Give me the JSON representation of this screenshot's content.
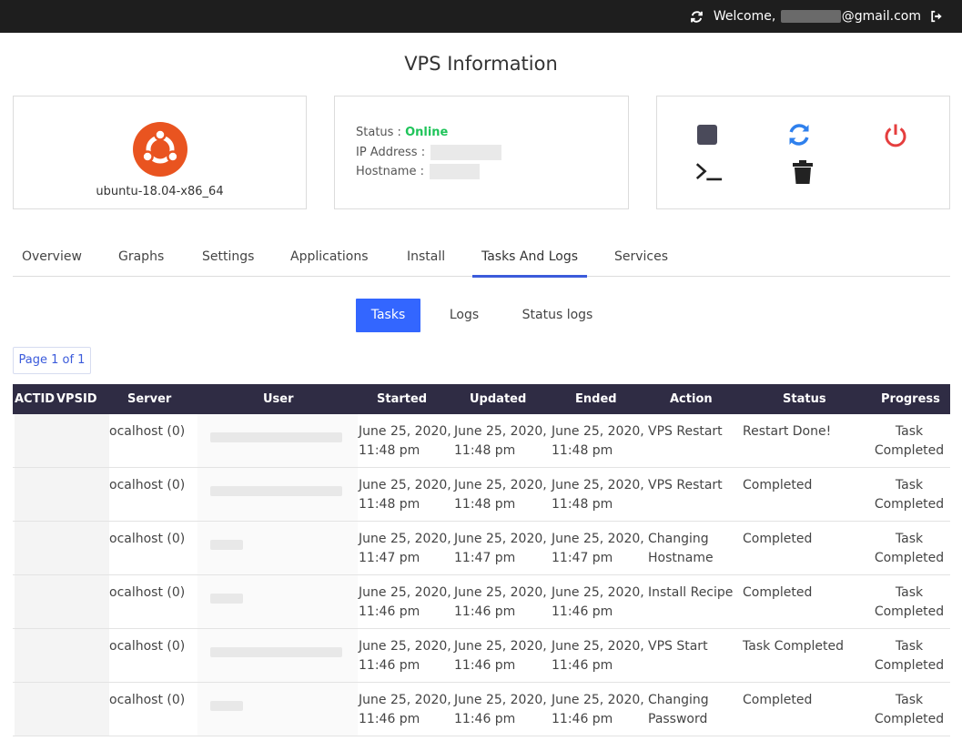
{
  "topbar": {
    "welcome_prefix": "Welcome, ",
    "email_redacted": "",
    "email_suffix": "@gmail.com",
    "refresh_icon": "refresh-icon",
    "logout_icon": "logout-icon"
  },
  "page_title": "VPS Information",
  "os": {
    "name": "ubuntu-18.04-x86_64",
    "logo_icon": "ubuntu-logo-icon",
    "logo_color": "#e95420"
  },
  "info": {
    "status_label": "Status : ",
    "status_value": "Online",
    "status_color": "#1fc45a",
    "ip_label": "IP Address : ",
    "ip_value": "",
    "hostname_label": "Hostname : ",
    "hostname_value": ""
  },
  "actions": {
    "stop_icon": "stop-icon",
    "restart_icon": "restart-icon",
    "power_icon": "power-icon",
    "console_icon": "console-icon",
    "delete_icon": "trash-icon",
    "accent_colors": {
      "stop": "#4a4a5a",
      "restart": "#2f80ed",
      "power": "#e53e3e",
      "console": "#222222",
      "delete": "#222222"
    }
  },
  "tabs": [
    "Overview",
    "Graphs",
    "Settings",
    "Applications",
    "Install",
    "Tasks And Logs",
    "Services"
  ],
  "active_tab": "Tasks And Logs",
  "subtabs": [
    "Tasks",
    "Logs",
    "Status logs"
  ],
  "active_subtab": "Tasks",
  "pagination": {
    "label": "Page 1 of 1"
  },
  "table": {
    "headers": [
      "ACTID",
      "VPSID",
      "Server",
      "User",
      "Started",
      "Updated",
      "Ended",
      "Action",
      "Status",
      "Progress"
    ],
    "rows": [
      {
        "actid": "",
        "vpsid": "",
        "server": "ocalhost (0)",
        "user": "",
        "started": [
          "June 25, 2020,",
          "11:48 pm"
        ],
        "updated": [
          "June 25, 2020,",
          "11:48 pm"
        ],
        "ended": [
          "June 25, 2020,",
          "11:48 pm"
        ],
        "action": [
          "VPS Restart",
          ""
        ],
        "status": "Restart Done!",
        "progress": [
          "Task",
          "Completed"
        ]
      },
      {
        "actid": "",
        "vpsid": "",
        "server": "ocalhost (0)",
        "user": "",
        "started": [
          "June 25, 2020,",
          "11:48 pm"
        ],
        "updated": [
          "June 25, 2020,",
          "11:48 pm"
        ],
        "ended": [
          "June 25, 2020,",
          "11:48 pm"
        ],
        "action": [
          "VPS Restart",
          ""
        ],
        "status": "Completed",
        "progress": [
          "Task",
          "Completed"
        ]
      },
      {
        "actid": "",
        "vpsid": "",
        "server": "ocalhost (0)",
        "user": "",
        "started": [
          "June 25, 2020,",
          "11:47 pm"
        ],
        "updated": [
          "June 25, 2020,",
          "11:47 pm"
        ],
        "ended": [
          "June 25, 2020,",
          "11:47 pm"
        ],
        "action": [
          "Changing",
          "Hostname"
        ],
        "status": "Completed",
        "progress": [
          "Task",
          "Completed"
        ]
      },
      {
        "actid": "",
        "vpsid": "",
        "server": "ocalhost (0)",
        "user": "",
        "started": [
          "June 25, 2020,",
          "11:46 pm"
        ],
        "updated": [
          "June 25, 2020,",
          "11:46 pm"
        ],
        "ended": [
          "June 25, 2020,",
          "11:46 pm"
        ],
        "action": [
          "Install Recipe",
          ""
        ],
        "status": "Completed",
        "progress": [
          "Task",
          "Completed"
        ]
      },
      {
        "actid": "",
        "vpsid": "",
        "server": "ocalhost (0)",
        "user": "",
        "started": [
          "June 25, 2020,",
          "11:46 pm"
        ],
        "updated": [
          "June 25, 2020,",
          "11:46 pm"
        ],
        "ended": [
          "June 25, 2020,",
          "11:46 pm"
        ],
        "action": [
          "VPS Start",
          ""
        ],
        "status": "Task Completed",
        "progress": [
          "Task",
          "Completed"
        ]
      },
      {
        "actid": "",
        "vpsid": "",
        "server": "ocalhost (0)",
        "user": "",
        "started": [
          "June 25, 2020,",
          "11:46 pm"
        ],
        "updated": [
          "June 25, 2020,",
          "11:46 pm"
        ],
        "ended": [
          "June 25, 2020,",
          "11:46 pm"
        ],
        "action": [
          "Changing",
          "Password"
        ],
        "status": "Completed",
        "progress": [
          "Task",
          "Completed"
        ]
      }
    ]
  },
  "colors": {
    "topbar": "#1e1e1e",
    "accent_blue": "#3366ff",
    "table_header": "#2f2c44"
  }
}
